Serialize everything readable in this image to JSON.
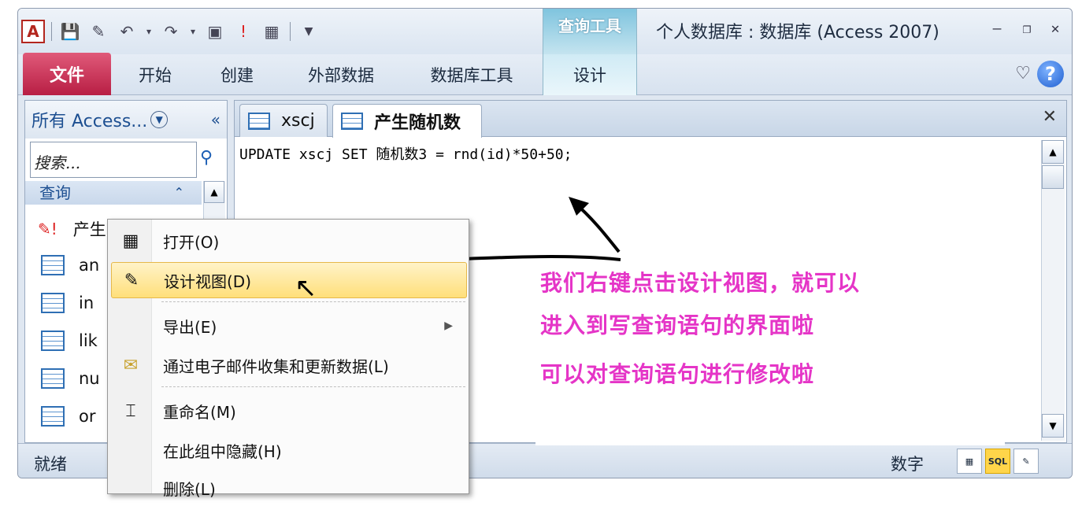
{
  "window": {
    "title": "个人数据库 : 数据库 (Access 2007)",
    "app_icon": "A",
    "context_header": "查询工具"
  },
  "quick_access": {
    "icons": [
      "save-icon",
      "design-icon",
      "undo-icon",
      "redo-icon",
      "view-icon",
      "run-icon",
      "table-icon",
      "customize-icon"
    ]
  },
  "ribbon": {
    "file": "文件",
    "tabs": [
      "开始",
      "创建",
      "外部数据",
      "数据库工具"
    ],
    "design": "设计",
    "help": "?"
  },
  "nav": {
    "title": "所有 Access...",
    "search_placeholder": "搜索...",
    "group": "查询",
    "items": [
      "产生随机数",
      "an",
      "in",
      "lik",
      "nu",
      "or"
    ]
  },
  "doc": {
    "tabs": [
      "xscj",
      "产生随机数"
    ],
    "sql": "UPDATE xscj SET 随机数3 = rnd(id)*50+50;"
  },
  "menu": {
    "items": [
      "打开(O)",
      "设计视图(D)",
      "导出(E)",
      "通过电子邮件收集和更新数据(L)",
      "重命名(M)",
      "在此组中隐藏(H)",
      "删除(L)"
    ]
  },
  "annotation": {
    "lines": [
      "我们右键点击设计视图，就可以",
      "进入到写查询语句的界面啦",
      "可以对查询语句进行修改啦"
    ],
    "color": "#e535c7"
  },
  "status": {
    "left": "就绪",
    "right": "数字",
    "sql_btn": "SQL"
  }
}
